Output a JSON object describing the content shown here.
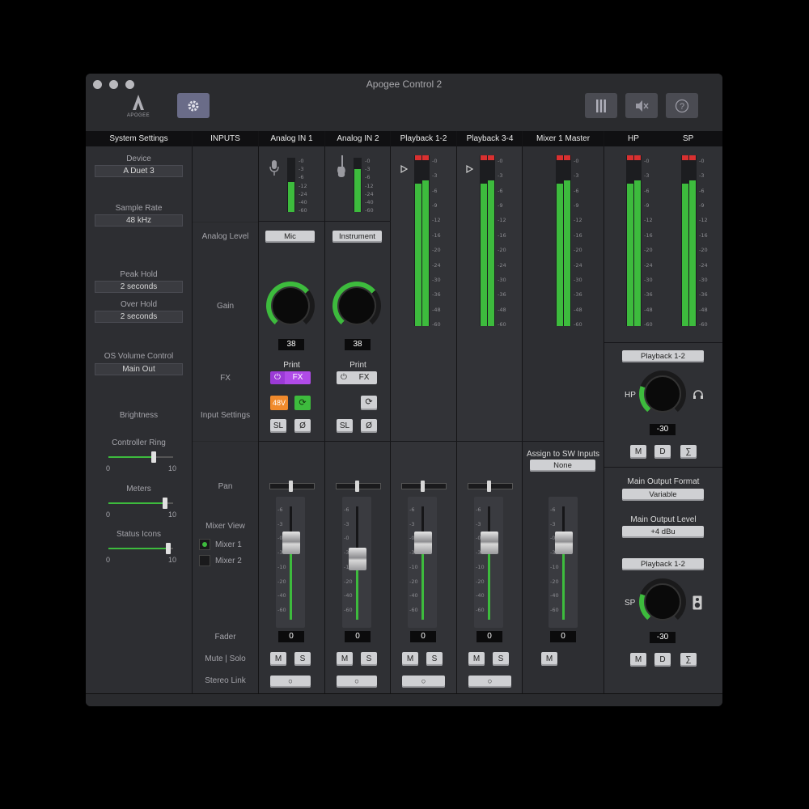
{
  "window": {
    "title": "Apogee Control 2",
    "brand": "APOGEE"
  },
  "headers": [
    "System Settings",
    "INPUTS",
    "Analog IN 1",
    "Analog IN 2",
    "Playback 1-2",
    "Playback 3-4",
    "Mixer 1 Master",
    "HP",
    "SP"
  ],
  "system": {
    "device_label": "Device",
    "device_value": "A Duet 3",
    "sample_rate_label": "Sample Rate",
    "sample_rate_value": "48 kHz",
    "peak_hold_label": "Peak Hold",
    "peak_hold_value": "2 seconds",
    "over_hold_label": "Over Hold",
    "over_hold_value": "2 seconds",
    "os_volume_label": "OS Volume Control",
    "os_volume_value": "Main Out",
    "brightness_label": "Brightness",
    "sliders": [
      {
        "label": "Controller Ring",
        "min": "0",
        "max": "10",
        "value": 0.7
      },
      {
        "label": "Meters",
        "min": "0",
        "max": "10",
        "value": 0.9
      },
      {
        "label": "Status Icons",
        "min": "0",
        "max": "10",
        "value": 0.95
      }
    ]
  },
  "inputs_labels": {
    "analog_level": "Analog Level",
    "gain": "Gain",
    "fx": "FX",
    "input_settings": "Input Settings",
    "pan": "Pan",
    "mixer_view": "Mixer View",
    "mixer1": "Mixer 1",
    "mixer2": "Mixer 2",
    "fader": "Fader",
    "mute_solo": "Mute | Solo",
    "stereo_link": "Stereo Link"
  },
  "meter_scale": [
    "0",
    "3",
    "6",
    "12",
    "24",
    "40",
    "60"
  ],
  "meter_scale_long": [
    "0",
    "3",
    "6",
    "9",
    "12",
    "16",
    "20",
    "24",
    "30",
    "36",
    "48",
    "60"
  ],
  "fader_scale": [
    "6",
    "3",
    "0",
    "3",
    "10",
    "20",
    "40",
    "60"
  ],
  "analog1": {
    "level": "Mic",
    "gain": "38",
    "print": "Print",
    "fx": "FX",
    "phantom": "48V",
    "sl": "SL",
    "phase": "Ø",
    "fader": "0",
    "m": "M",
    "s": "S",
    "link": "○"
  },
  "analog2": {
    "level": "Instrument",
    "gain": "38",
    "print": "Print",
    "fx": "FX",
    "sl": "SL",
    "phase": "Ø",
    "fader": "0",
    "m": "M",
    "s": "S",
    "link": "○"
  },
  "pb12": {
    "fader": "0",
    "m": "M",
    "s": "S",
    "link": "○"
  },
  "pb34": {
    "fader": "0",
    "m": "M",
    "s": "S",
    "link": "○"
  },
  "master": {
    "assign_label": "Assign to SW Inputs",
    "assign_value": "None",
    "fader": "0",
    "m": "M"
  },
  "hp": {
    "source": "Playback 1-2",
    "label": "HP",
    "value": "-30",
    "m": "M",
    "d": "D",
    "sum": "∑"
  },
  "main_output": {
    "format_label": "Main Output Format",
    "format_value": "Variable",
    "level_label": "Main Output Level",
    "level_value": "+4 dBu"
  },
  "sp": {
    "source": "Playback 1-2",
    "label": "SP",
    "value": "-30",
    "m": "M",
    "d": "D",
    "sum": "∑"
  },
  "colors": {
    "accent_green": "#3dbb3d",
    "fx_purple": "#a23de0",
    "phantom_orange": "#f08a2c",
    "meter_red": "#d93030"
  }
}
